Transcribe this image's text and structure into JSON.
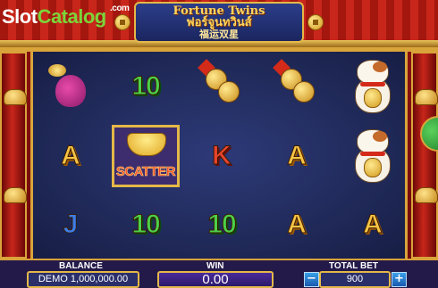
{
  "watermark": {
    "slot": "Slot",
    "catalog": "Catalog",
    "com": ".com"
  },
  "logo": {
    "title": "Fortune Twins",
    "thai": "ฟอร์จูนทวินส์",
    "chinese": "福运双星"
  },
  "reels": {
    "columns": [
      [
        "money-pouch",
        "A",
        "J"
      ],
      [
        "10",
        "SCATTER",
        "10"
      ],
      [
        "coin-charm",
        "K",
        "10"
      ],
      [
        "coin-charm",
        "A",
        "A"
      ],
      [
        "lucky-cat",
        "lucky-cat",
        "A"
      ]
    ],
    "scatter_label": "SCATTER"
  },
  "bottom_bar": {
    "balance_label": "BALANCE",
    "balance_value": "DEMO 1,000,000.00",
    "win_label": "WIN",
    "win_value": "0.00",
    "total_bet_label": "TOTAL BET",
    "total_bet_value": "900",
    "minus_label": "−",
    "plus_label": "+"
  },
  "colors": {
    "roof_red": "#c8261a",
    "gold": "#d9a43a",
    "reel_bg": "#1e2754",
    "bar_bg": "#241a4a"
  }
}
